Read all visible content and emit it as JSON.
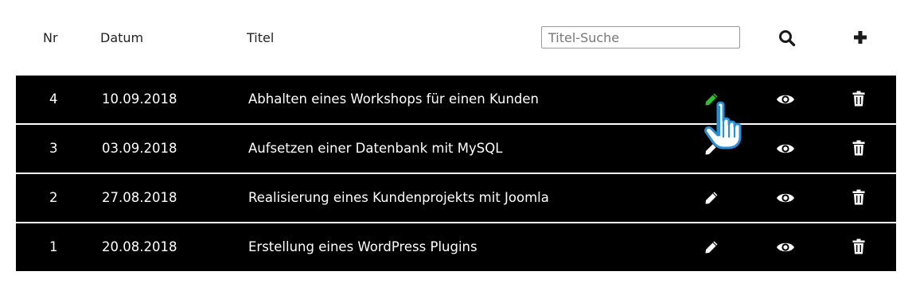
{
  "header": {
    "nr_label": "Nr",
    "date_label": "Datum",
    "title_label": "Titel",
    "search": {
      "placeholder": "Titel-Suche",
      "value": ""
    },
    "search_icon": "search-icon",
    "add_icon": "plus-icon"
  },
  "rows": [
    {
      "nr": "4",
      "date": "10.09.2018",
      "title": "Abhalten eines Workshops für einen Kunden",
      "edit_active": true
    },
    {
      "nr": "3",
      "date": "03.09.2018",
      "title": "Aufsetzen einer Datenbank mit MySQL",
      "edit_active": false
    },
    {
      "nr": "2",
      "date": "27.08.2018",
      "title": "Realisierung eines Kundenprojekts mit Joomla",
      "edit_active": false
    },
    {
      "nr": "1",
      "date": "20.08.2018",
      "title": "Erstellung eines WordPress Plugins",
      "edit_active": false
    }
  ],
  "row_icons": {
    "edit": "pencil-icon",
    "view": "eye-icon",
    "delete": "trash-icon"
  },
  "colors": {
    "row_background": "#000000",
    "row_text": "#ffffff",
    "edit_active": "#2fbf2f",
    "edit_default": "#ffffff",
    "cursor_blue": "#2a8fd6"
  }
}
